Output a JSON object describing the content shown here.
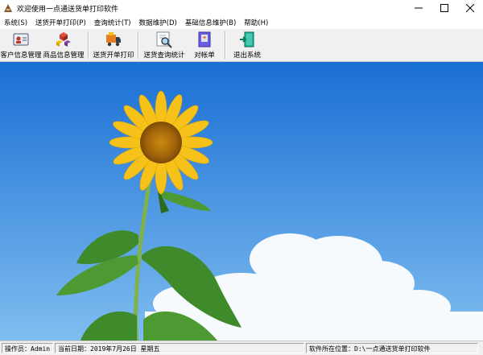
{
  "window": {
    "title": "欢迎使用一点通送货单打印软件",
    "controls": [
      "minimize-icon",
      "maximize-icon",
      "close-icon"
    ]
  },
  "menu": [
    {
      "label": "系统(S)"
    },
    {
      "label": "送货开单打印(P)"
    },
    {
      "label": "查询统计(T)"
    },
    {
      "label": "数据维护(D)"
    },
    {
      "label": "基础信息维护(B)"
    },
    {
      "label": "帮助(H)"
    }
  ],
  "toolbar": [
    {
      "label": "客户信息管理",
      "icon": "customer-card-icon"
    },
    {
      "label": "商品信息管理",
      "icon": "products-boxes-icon"
    },
    {
      "label": "送货开单打印",
      "icon": "delivery-truck-icon"
    },
    {
      "label": "送货查询统计",
      "icon": "search-magnifier-icon"
    },
    {
      "label": "对帐单",
      "icon": "statement-book-icon"
    },
    {
      "label": "退出系统",
      "icon": "exit-door-icon"
    }
  ],
  "status": {
    "operator": "操作员：Admin",
    "date": "当前日期：2019年7月26日 星期五",
    "location": "软件所在位置：D:\\一点通送货单打印软件"
  },
  "colors": {
    "sky_top": "#1a6fd4",
    "sky_bottom": "#7fbdf0",
    "petal": "#f6c21a",
    "leaf": "#3f8a2a"
  }
}
